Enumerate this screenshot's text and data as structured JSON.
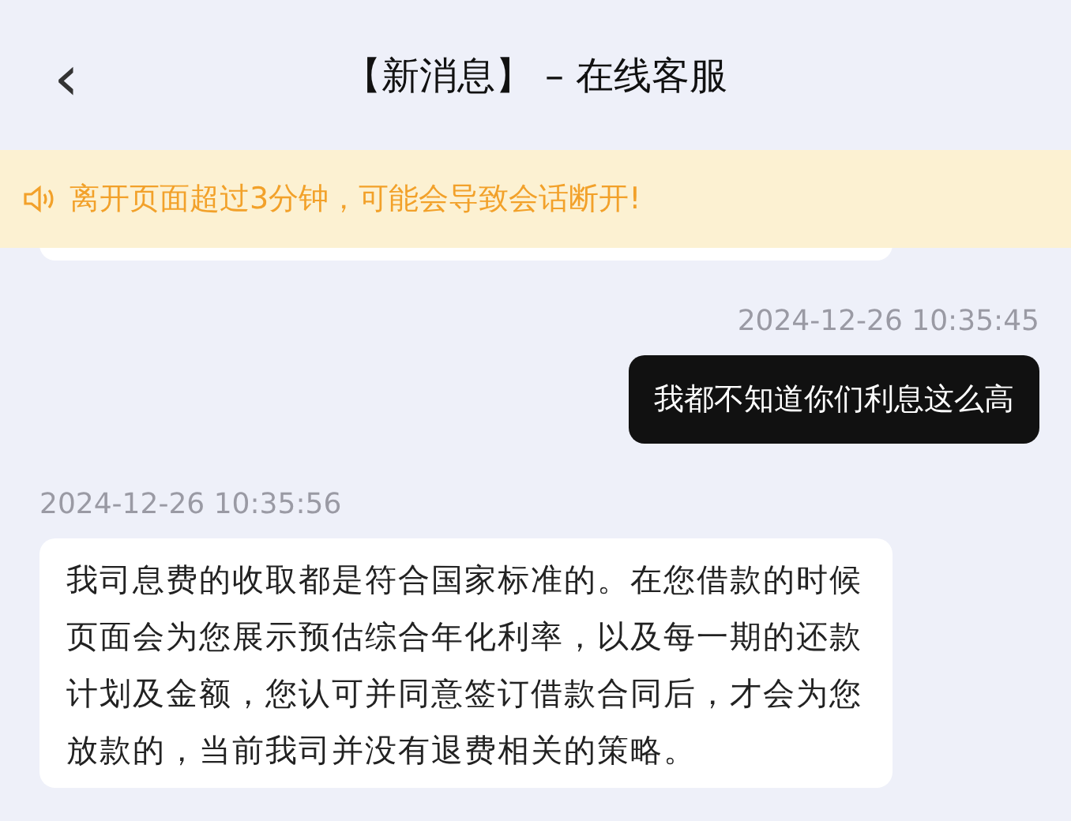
{
  "header": {
    "back": "‹",
    "title": "【新消息】 – 在线客服"
  },
  "notice": {
    "text": "离开页面超过3分钟，可能会导致会话断开!"
  },
  "messages": [
    {
      "kind": "partial",
      "outgoing": false
    },
    {
      "kind": "text",
      "outgoing": true,
      "time": "2024-12-26 10:35:45",
      "text": "我都不知道你们利息这么高"
    },
    {
      "kind": "text",
      "outgoing": false,
      "time": "2024-12-26 10:35:56",
      "text": "我司息费的收取都是符合国家标准的。在您借款的时候页面会为您展示预估综合年化利率，以及每一期的还款计划及金额，您认可并同意签订借款合同后，才会为您放款的，当前我司并没有退费相关的策略。"
    }
  ]
}
